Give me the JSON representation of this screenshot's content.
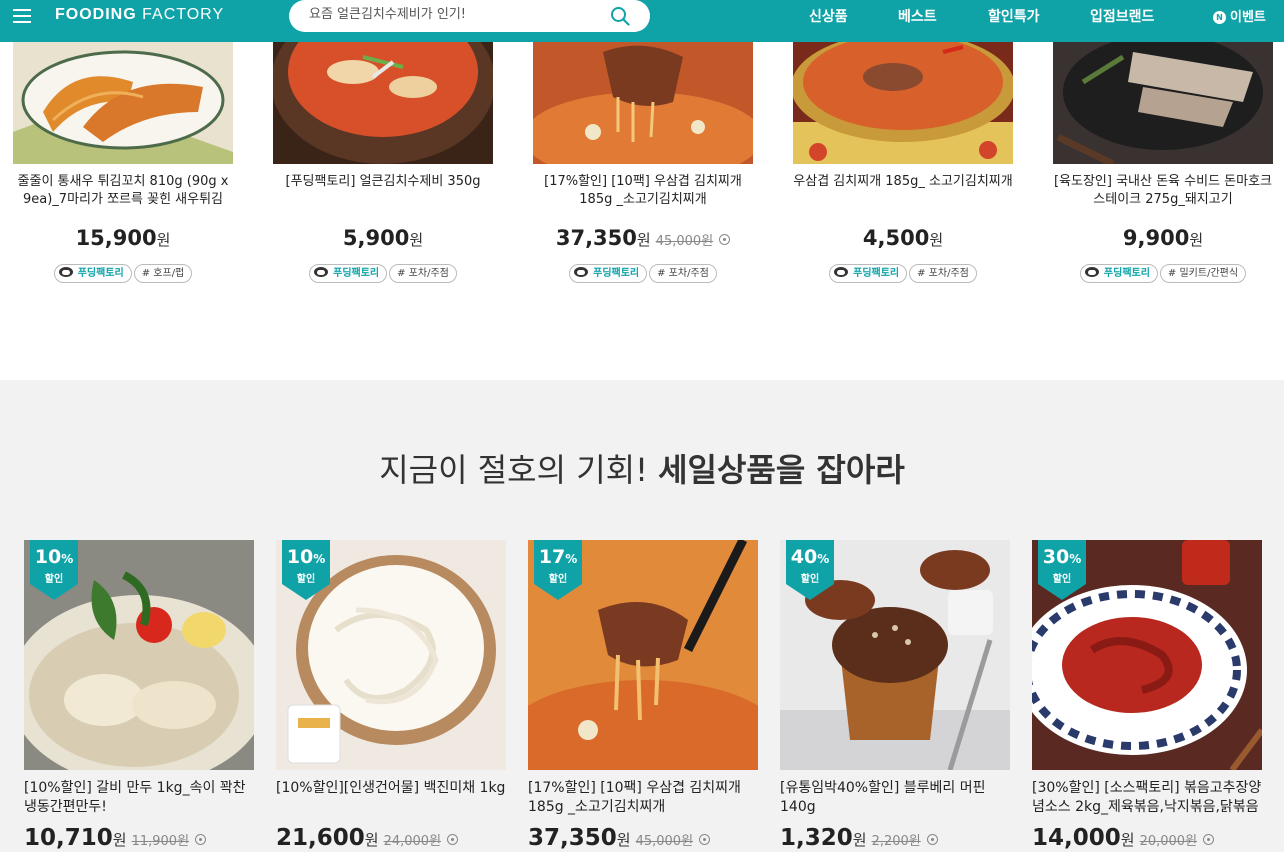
{
  "header": {
    "logo_bold": "FOODING",
    "logo_light": "FACTORY",
    "search_placeholder": "요즘 얼큰김치수제비가 인기!",
    "nav": [
      "신상품",
      "베스트",
      "할인특가",
      "입점브랜드"
    ],
    "event_badge": "N",
    "event_label": "이벤트",
    "accent": "#0fa3a8"
  },
  "top_products": [
    {
      "name": "줄줄이 통새우 튀김꼬치 810g (90g x 9ea)_7마리가 쪼르륵 꽂힌 새우튀김",
      "price": "15,900",
      "unit": "원",
      "orig": "",
      "brand": "푸딩팩토리",
      "tag": "# 호프/펍"
    },
    {
      "name": "[푸딩팩토리] 얼큰김치수제비 350g",
      "price": "5,900",
      "unit": "원",
      "orig": "",
      "brand": "푸딩팩토리",
      "tag": "# 포차/주점"
    },
    {
      "name": "[17%할인] [10팩] 우삼겹 김치찌개 185g _소고기김치찌개",
      "price": "37,350",
      "unit": "원",
      "orig": "45,000원",
      "brand": "푸딩팩토리",
      "tag": "# 포차/주점"
    },
    {
      "name": "우삼겹 김치찌개 185g_ 소고기김치찌개",
      "price": "4,500",
      "unit": "원",
      "orig": "",
      "brand": "푸딩팩토리",
      "tag": "# 포차/주점"
    },
    {
      "name": "[육도장인] 국내산 돈육 수비드 돈마호크 스테이크 275g_돼지고기",
      "price": "9,900",
      "unit": "원",
      "orig": "",
      "brand": "푸딩팩토리",
      "tag": "# 밀키트/간편식"
    }
  ],
  "sale_section": {
    "title_light": "지금이 절호의 기회!",
    "title_bold": "세일상품을 잡아라"
  },
  "sale_products": [
    {
      "discount": "10",
      "pct_sign": "%",
      "discount_label": "할인",
      "name": "[10%할인] 갈비 만두 1kg_속이 꽉찬 냉동간편만두!",
      "price": "10,710",
      "unit": "원",
      "orig": "11,900원"
    },
    {
      "discount": "10",
      "pct_sign": "%",
      "discount_label": "할인",
      "name": "[10%할인][인생건어물] 백진미채 1kg",
      "price": "21,600",
      "unit": "원",
      "orig": "24,000원"
    },
    {
      "discount": "17",
      "pct_sign": "%",
      "discount_label": "할인",
      "name": "[17%할인] [10팩] 우삼겹 김치찌개 185g _소고기김치찌개",
      "price": "37,350",
      "unit": "원",
      "orig": "45,000원"
    },
    {
      "discount": "40",
      "pct_sign": "%",
      "discount_label": "할인",
      "name": "[유통임박40%할인] 블루베리 머핀 140g",
      "price": "1,320",
      "unit": "원",
      "orig": "2,200원"
    },
    {
      "discount": "30",
      "pct_sign": "%",
      "discount_label": "할인",
      "name": "[30%할인] [소스팩토리] 볶음고추장양념소스 2kg_제육볶음,낙지볶음,닭볶음",
      "price": "14,000",
      "unit": "원",
      "orig": "20,000원"
    }
  ]
}
